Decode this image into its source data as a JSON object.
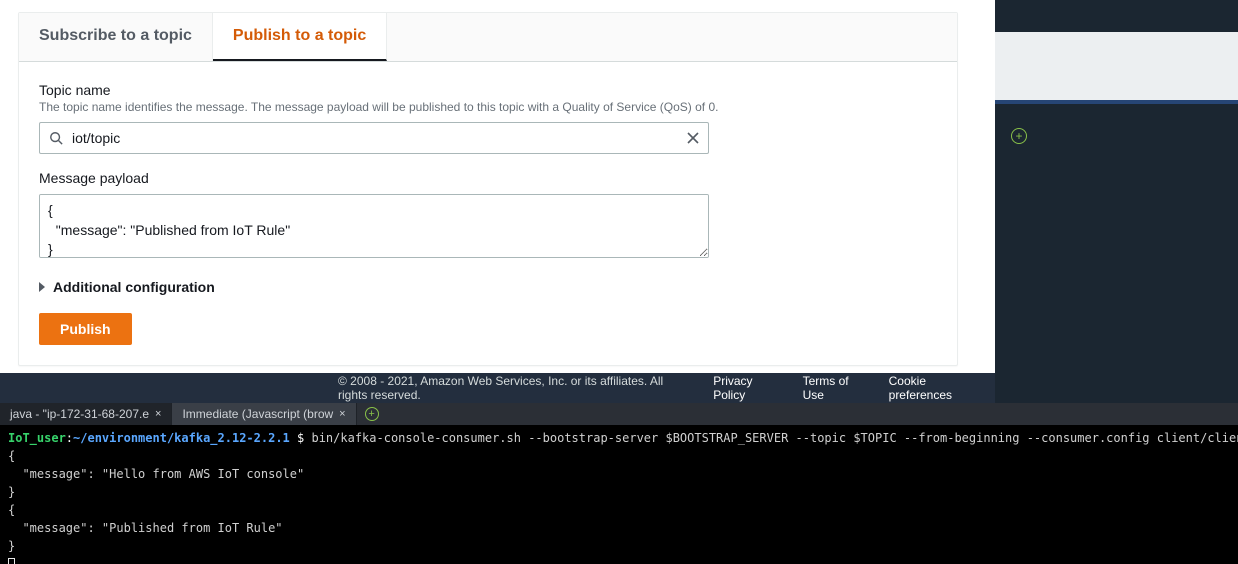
{
  "tabs": {
    "subscribe": "Subscribe to a topic",
    "publish": "Publish to a topic"
  },
  "topic": {
    "label": "Topic name",
    "desc": "The topic name identifies the message. The message payload will be published to this topic with a Quality of Service (QoS) of 0.",
    "value": "iot/topic"
  },
  "payload": {
    "label": "Message payload",
    "value": "{\n  \"message\": \"Published from IoT Rule\"\n}"
  },
  "expander": {
    "label": "Additional configuration"
  },
  "buttons": {
    "publish": "Publish"
  },
  "footer": {
    "copyright": "© 2008 - 2021, Amazon Web Services, Inc. or its affiliates. All rights reserved.",
    "privacy": "Privacy Policy",
    "terms": "Terms of Use",
    "cookies": "Cookie preferences"
  },
  "ide": {
    "tab1": "java - \"ip-172-31-68-207.e",
    "tab2": "Immediate (Javascript (brow"
  },
  "terminal": {
    "user": "IoT_user",
    "host": ":",
    "path": "~/environment/kafka_2.12-2.2.1",
    "prompt": " $ ",
    "cmd": "bin/kafka-console-consumer.sh --bootstrap-server $BOOTSTRAP_SERVER --topic $TOPIC --from-beginning --consumer.config client/client_sasl.properties",
    "out1": "{",
    "out2": "  \"message\": \"Hello from AWS IoT console\"",
    "out3": "}",
    "out4": "{",
    "out5": "  \"message\": \"Published from IoT Rule\"",
    "out6": "}"
  }
}
